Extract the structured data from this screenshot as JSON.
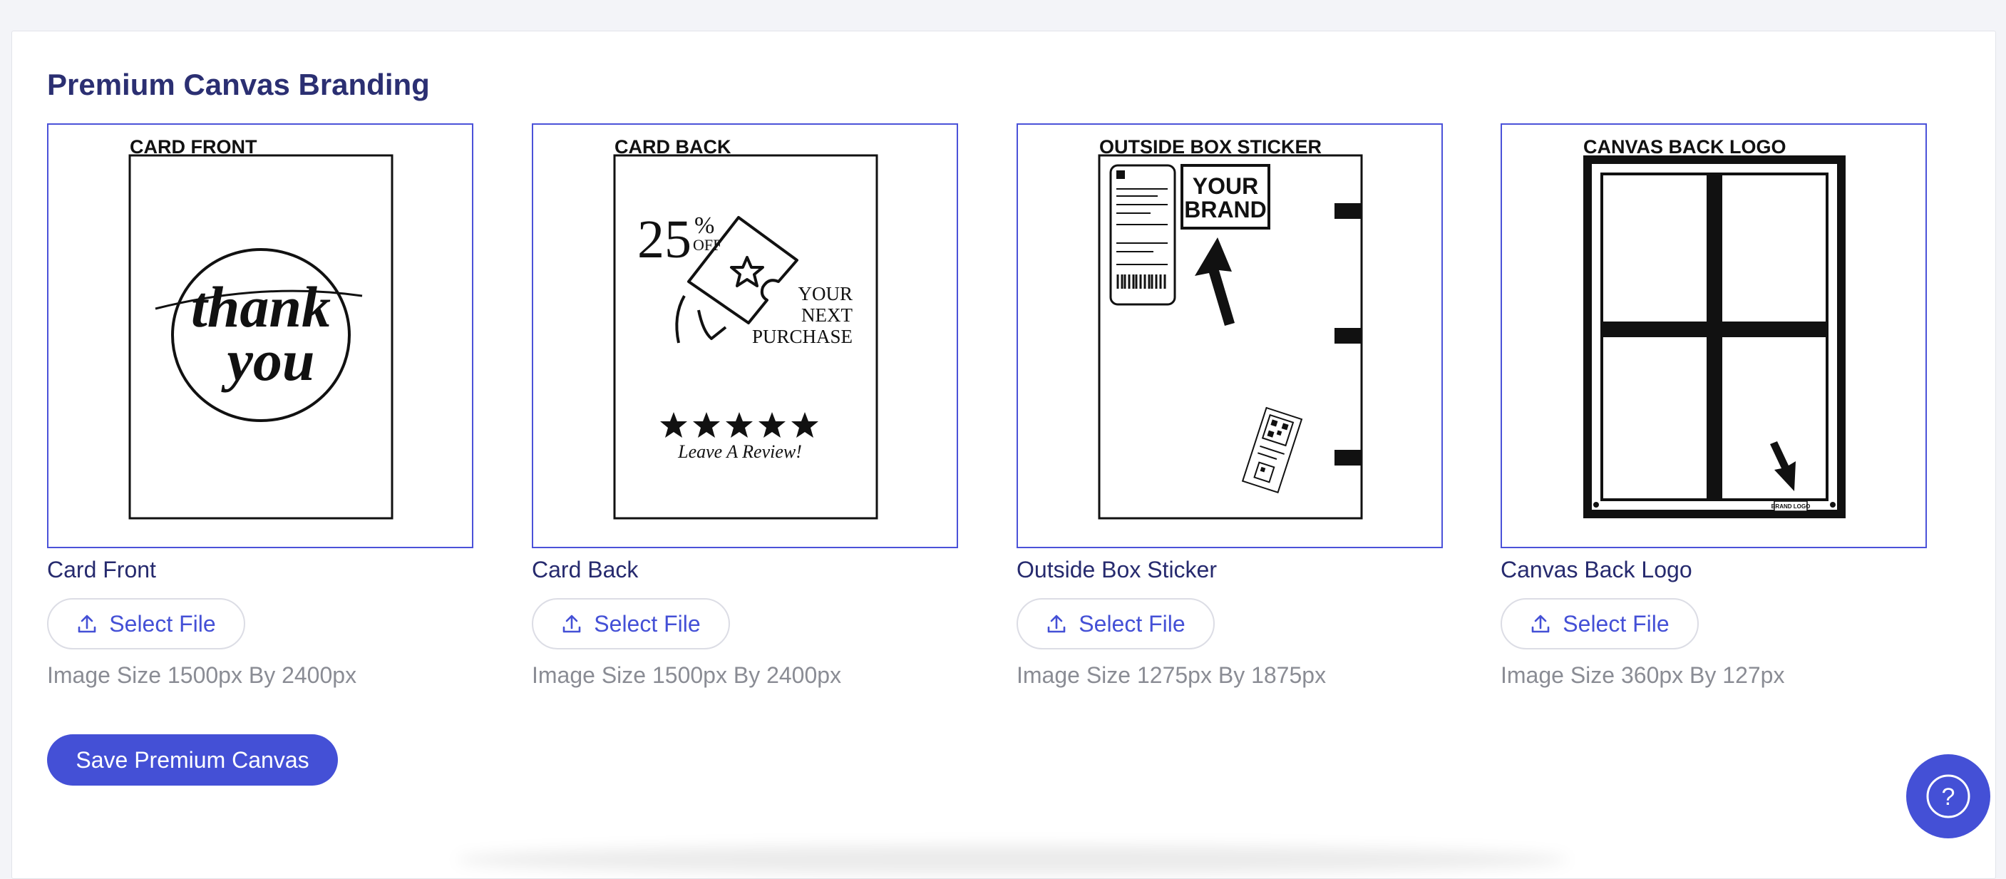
{
  "section": {
    "title": "Premium Canvas Branding"
  },
  "cards": [
    {
      "header": "CARD FRONT",
      "label": "Card Front",
      "button": "Select File",
      "size": "Image Size 1500px By 2400px",
      "art": {
        "line1": "thank",
        "line2": "you"
      }
    },
    {
      "header": "CARD BACK",
      "label": "Card Back",
      "button": "Select File",
      "size": "Image Size 1500px By 2400px",
      "art": {
        "discount": "25",
        "percent": "%",
        "off": "OFF",
        "line1": "YOUR",
        "line2": "NEXT",
        "line3": "PURCHASE",
        "review": "Leave A Review!"
      }
    },
    {
      "header": "OUTSIDE BOX STICKER",
      "label": "Outside Box Sticker",
      "button": "Select File",
      "size": "Image Size 1275px By 1875px",
      "art": {
        "brand1": "YOUR",
        "brand2": "BRAND"
      }
    },
    {
      "header": "CANVAS BACK LOGO",
      "label": "Canvas Back Logo",
      "button": "Select File",
      "size": "Image Size 360px By 127px",
      "art": {
        "tag": "BRAND LOGO"
      }
    }
  ],
  "save_button": "Save Premium Canvas",
  "help_button": "?",
  "icons": {
    "upload": "upload-icon",
    "help": "question-circle-icon"
  },
  "colors": {
    "accent": "#4450d6",
    "title": "#2b2f72",
    "border": "#4b52d9"
  }
}
